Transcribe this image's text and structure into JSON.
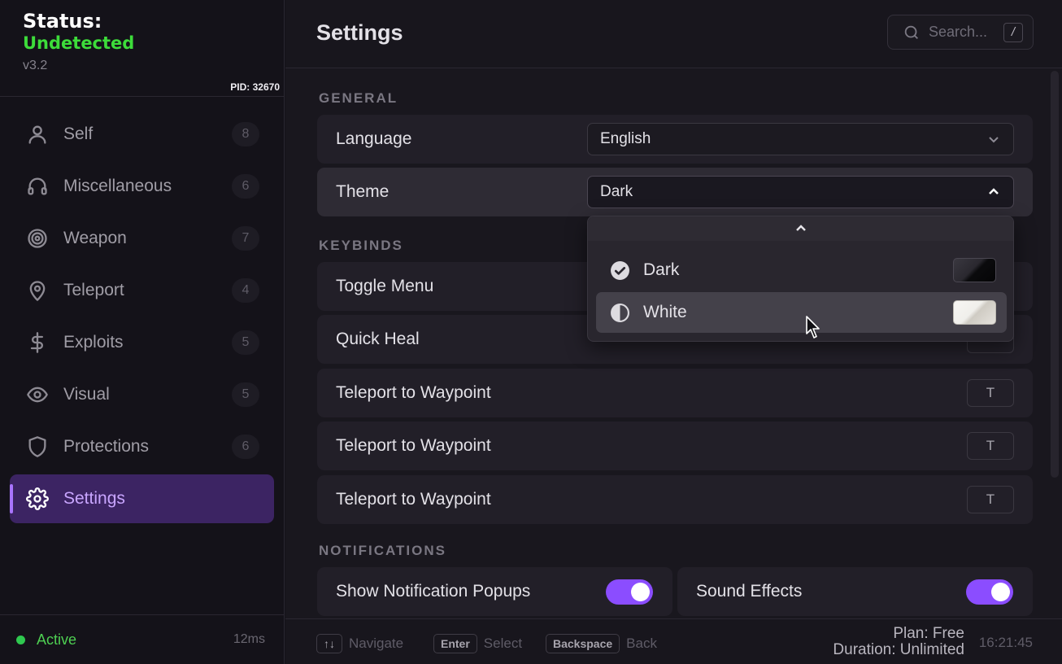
{
  "status": {
    "title": "Status:",
    "value": "Undetected",
    "version": "v3.2",
    "pid": "PID: 32670"
  },
  "sidebar": {
    "items": [
      {
        "label": "Self",
        "count": "8",
        "icon": "user-icon"
      },
      {
        "label": "Miscellaneous",
        "count": "6",
        "icon": "headset-icon"
      },
      {
        "label": "Weapon",
        "count": "7",
        "icon": "target-icon"
      },
      {
        "label": "Teleport",
        "count": "4",
        "icon": "map-pin-icon"
      },
      {
        "label": "Exploits",
        "count": "5",
        "icon": "dollar-icon"
      },
      {
        "label": "Visual",
        "count": "5",
        "icon": "eye-icon"
      },
      {
        "label": "Protections",
        "count": "6",
        "icon": "shield-icon"
      },
      {
        "label": "Settings",
        "icon": "gear-icon",
        "active": true
      }
    ],
    "footer": {
      "status": "Active",
      "latency": "12ms"
    }
  },
  "header": {
    "title": "Settings",
    "search_placeholder": "Search...",
    "search_shortcut": "/"
  },
  "sections": {
    "general": "GENERAL",
    "keybinds": "KEYBINDS",
    "notifications": "NOTIFICATIONS"
  },
  "general": {
    "language_label": "Language",
    "language_value": "English",
    "theme_label": "Theme",
    "theme_value": "Dark"
  },
  "theme_dropdown": {
    "options": [
      {
        "label": "Dark",
        "selected": true,
        "icon": "check-circle-icon"
      },
      {
        "label": "White",
        "selected": false,
        "hovered": true,
        "icon": "half-circle-icon"
      }
    ]
  },
  "keybinds": [
    {
      "label": "Toggle Menu",
      "key": ""
    },
    {
      "label": "Quick Heal",
      "key": ""
    },
    {
      "label": "Teleport to Waypoint",
      "key": "T"
    },
    {
      "label": "Teleport to Waypoint",
      "key": "T"
    },
    {
      "label": "Teleport to Waypoint",
      "key": "T"
    }
  ],
  "notifications": [
    {
      "label": "Show Notification Popups",
      "enabled": true
    },
    {
      "label": "Sound Effects",
      "enabled": true
    }
  ],
  "footer": {
    "hints": [
      {
        "key": "↑↓",
        "label": "Navigate"
      },
      {
        "key": "Enter",
        "label": "Select"
      },
      {
        "key": "Backspace",
        "label": "Back"
      }
    ],
    "plan": "Plan: Free",
    "duration": "Duration: Unlimited",
    "clock": "16:21:45"
  },
  "colors": {
    "accent": "#8b4dff",
    "active_nav_bg": "#3c2463",
    "status_green": "#3ddc3a",
    "background": "#141219"
  }
}
